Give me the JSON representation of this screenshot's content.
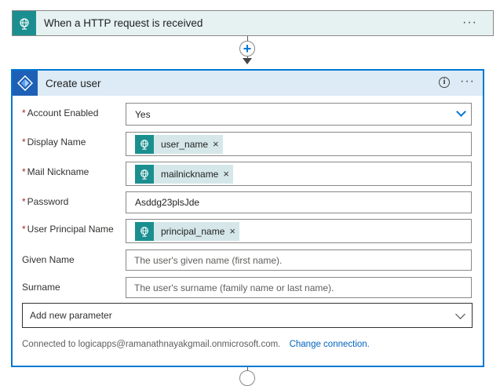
{
  "trigger": {
    "title": "When a HTTP request is received",
    "icon": "http-request-globe-icon",
    "more_label": "···"
  },
  "action": {
    "title": "Create user",
    "icon": "azure-ad-icon",
    "info_label": "i",
    "more_label": "···",
    "fields": {
      "account_enabled": {
        "label": "Account Enabled",
        "required": true,
        "value": "Yes"
      },
      "display_name": {
        "label": "Display Name",
        "required": true,
        "token": "user_name"
      },
      "mail_nickname": {
        "label": "Mail Nickname",
        "required": true,
        "token": "mailnickname"
      },
      "password": {
        "label": "Password",
        "required": true,
        "value": "Asddg23plsJde"
      },
      "user_principal_name": {
        "label": "User Principal Name",
        "required": true,
        "token": "principal_name"
      },
      "given_name": {
        "label": "Given Name",
        "required": false,
        "placeholder": "The user's given name (first name)."
      },
      "surname": {
        "label": "Surname",
        "required": false,
        "placeholder": "The user's surname (family name or last name)."
      }
    },
    "required_marker": "*",
    "token_remove": "×",
    "add_parameter": "Add new parameter",
    "connection_text": "Connected to logicapps@ramanathnayakgmail.onmicrosoft.com.",
    "change_connection": "Change connection."
  },
  "connector": {
    "add_label": "+"
  },
  "colors": {
    "trigger_accent": "#1b8f8f",
    "action_accent": "#1e60b5",
    "selected_border": "#0078d4",
    "required": "#a4262c",
    "link": "#0064bf"
  }
}
